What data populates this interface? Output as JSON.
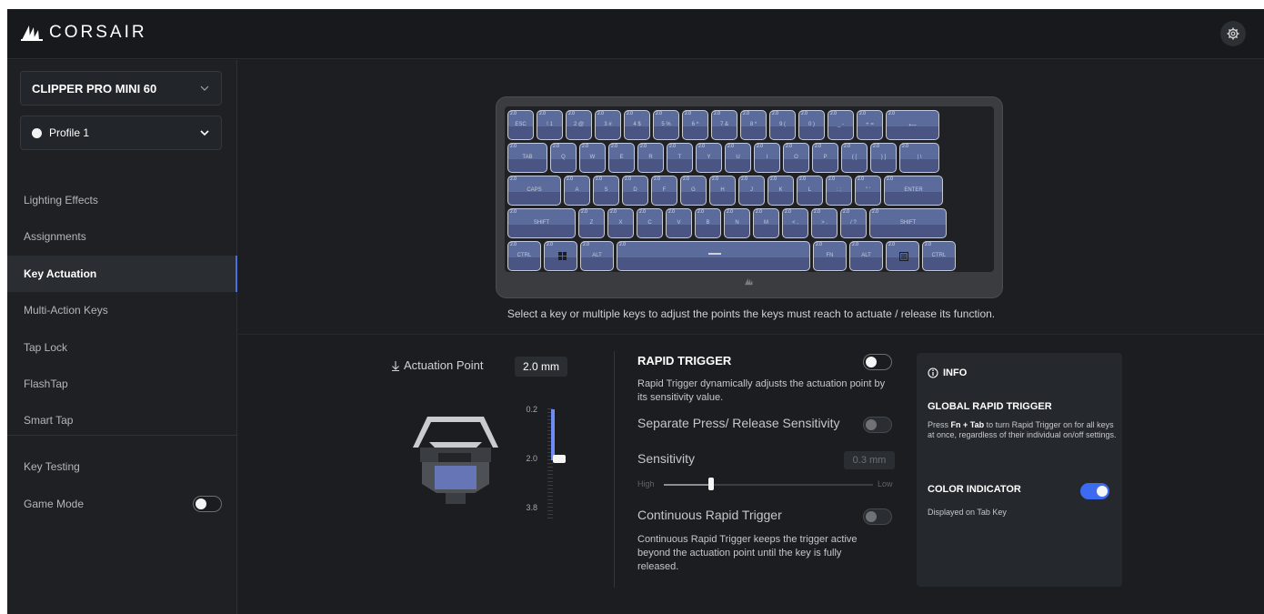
{
  "app": {
    "brand": "CORSAIR"
  },
  "sidebar": {
    "device": "CLIPPER PRO MINI 60",
    "profile": "Profile 1",
    "items": [
      {
        "label": "Lighting Effects"
      },
      {
        "label": "Assignments"
      },
      {
        "label": "Key Actuation",
        "active": true
      },
      {
        "label": "Multi-Action Keys"
      },
      {
        "label": "Tap Lock"
      },
      {
        "label": "FlashTap"
      },
      {
        "label": "Smart Tap"
      }
    ],
    "key_testing": "Key Testing",
    "game_mode": {
      "label": "Game Mode",
      "enabled": false
    }
  },
  "keyboard": {
    "actuation_point_mark": "2.0",
    "rows": [
      [
        "ESC",
        "! 1",
        "2 @",
        "3 #",
        "4 $",
        "5 %",
        "6 ^",
        "7 &",
        "8 *",
        "9 (",
        "0 )",
        "_ -",
        "+ =",
        "⟵"
      ],
      [
        "TAB",
        "Q",
        "W",
        "E",
        "R",
        "T",
        "Y",
        "U",
        "I",
        "O",
        "P",
        "{ [",
        "} ]",
        "| \\"
      ],
      [
        "CAPS",
        "A",
        "S",
        "D",
        "F",
        "G",
        "H",
        "J",
        "K",
        "L",
        ": ;",
        "\" '",
        "ENTER"
      ],
      [
        "SHIFT",
        "Z",
        "X",
        "C",
        "V",
        "B",
        "N",
        "M",
        "< ,",
        "> .",
        "/ ?",
        "SHIFT"
      ],
      [
        "CTRL",
        "win-icon",
        "ALT",
        "space",
        "FN",
        "ALT",
        "menu-icon",
        "CTRL"
      ]
    ],
    "caption": "Select a key or multiple keys to adjust the points the keys must reach to actuate / release its function."
  },
  "actuation": {
    "label": "Actuation Point",
    "value": "2.0 mm",
    "ticks": [
      "0.2",
      "2.0",
      "3.8"
    ],
    "level_mm": 2.0
  },
  "rapid_trigger": {
    "title": "RAPID TRIGGER",
    "enabled": false,
    "description": "Rapid Trigger dynamically adjusts the actuation point by its sensitivity value.",
    "separate_label": "Separate Press/ Release Sensitivity",
    "sensitivity_label": "Sensitivity",
    "sensitivity_value": "0.3 mm",
    "slider_high": "High",
    "slider_low": "Low",
    "continuous_label": "Continuous Rapid Trigger",
    "continuous_desc": "Continuous Rapid Trigger keeps the trigger active beyond the actuation point until the key is fully released."
  },
  "info": {
    "header": "INFO",
    "global_title": "GLOBAL RAPID TRIGGER",
    "global_pre": "Press ",
    "global_key": "Fn + Tab",
    "global_post": " to turn Rapid Trigger on for all keys at once, regardless of their individual on/off settings.",
    "color_title": "COLOR INDICATOR",
    "color_enabled": true,
    "color_desc": "Displayed on Tab Key"
  },
  "colors": {
    "accent": "#3c6af0",
    "key_fill": "#5b6b9c"
  }
}
